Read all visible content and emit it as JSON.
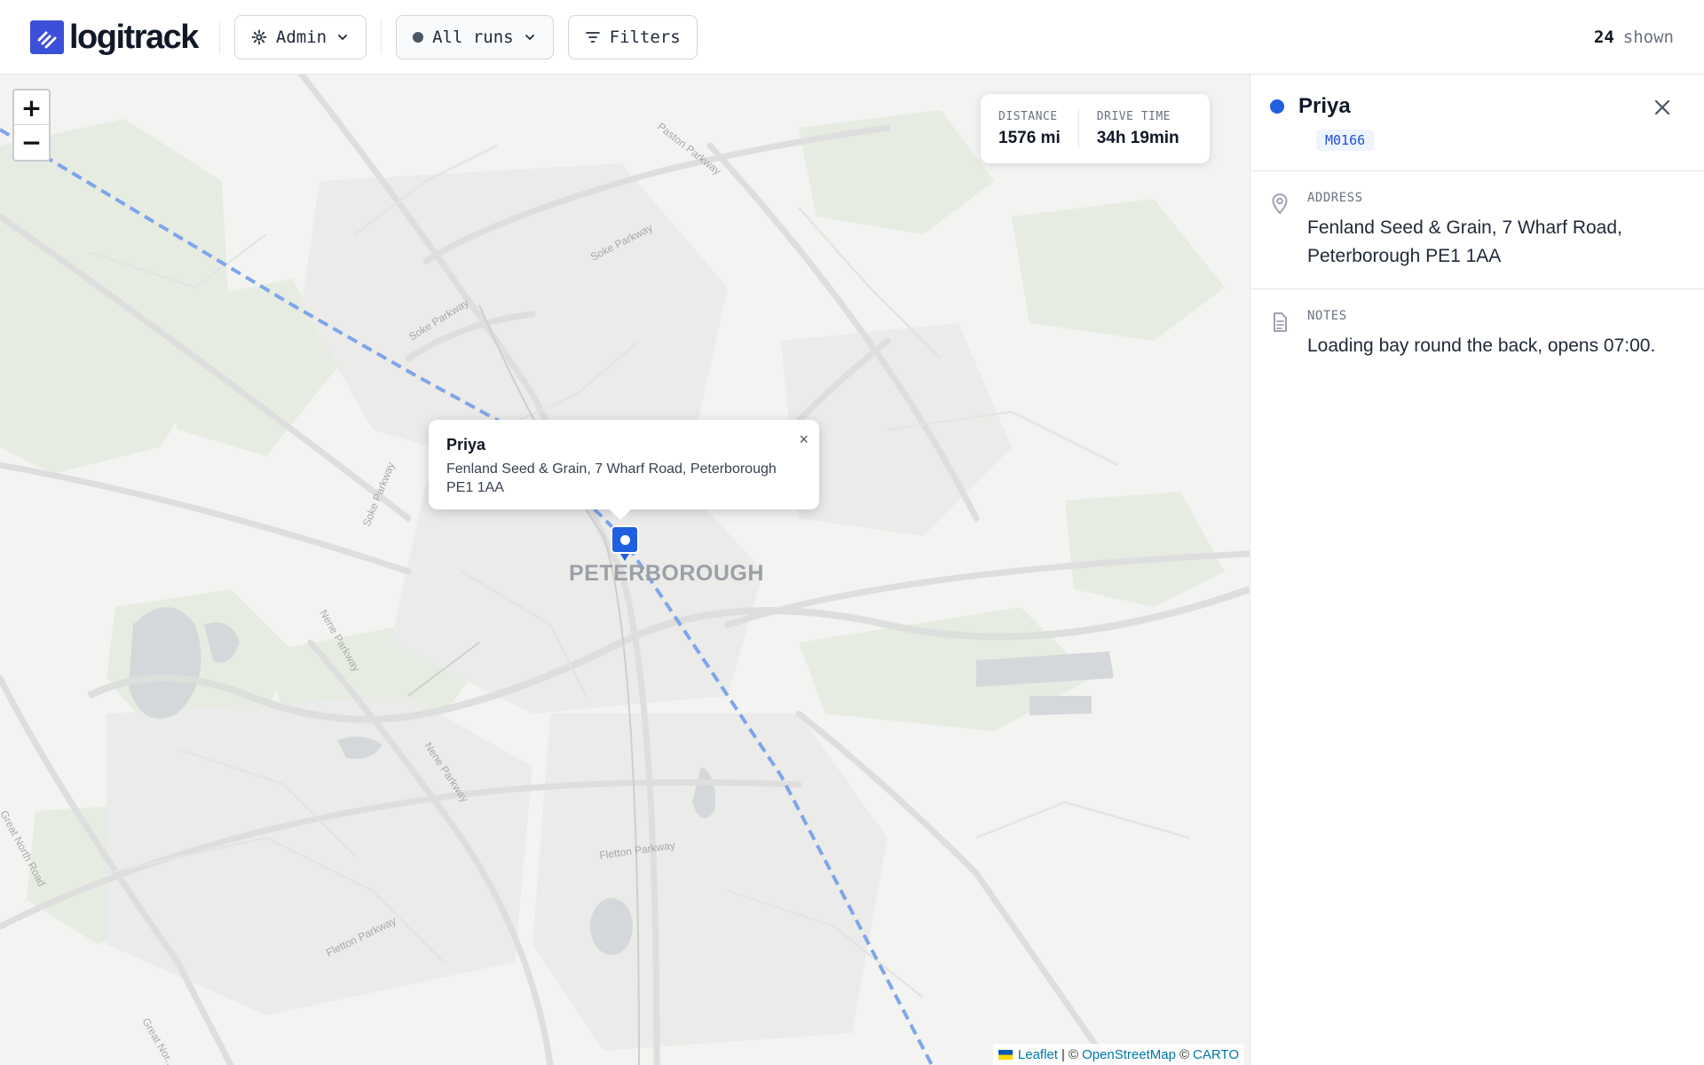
{
  "header": {
    "logo": "logitrack",
    "role_label": "Admin",
    "runs_label": "All runs",
    "filters_label": "Filters",
    "shown_count": "24",
    "shown_label": "shown"
  },
  "map": {
    "zoom_in": "+",
    "zoom_out": "−",
    "city_label": "PETERBOROUGH",
    "road_labels": [
      "Paston Parkway",
      "Soke Parkway",
      "Soke Parkway",
      "Soke Parkway",
      "Nene Parkway",
      "Nene Parkway",
      "Fletton Parkway",
      "Fletton Parkway",
      "Great North Road",
      "Great Nor..."
    ],
    "stats": {
      "distance_label": "DISTANCE",
      "distance_value": "1576 mi",
      "drive_time_label": "DRIVE TIME",
      "drive_time_value": "34h 19min"
    },
    "popup": {
      "title": "Priya",
      "address": "Fenland Seed & Grain, 7 Wharf Road, Peterborough PE1 1AA",
      "close": "×"
    },
    "attribution": {
      "leaflet": "Leaflet",
      "sep1": "| ©",
      "osm": "OpenStreetMap",
      "sep2": "©",
      "carto": "CARTO"
    },
    "route_color": "#7fa5ea",
    "marker_color": "#1f5fe0"
  },
  "panel": {
    "name": "Priya",
    "code": "M0166",
    "address_label": "ADDRESS",
    "address": "Fenland Seed & Grain, 7 Wharf Road, Peterborough PE1 1AA",
    "notes_label": "NOTES",
    "notes": "Loading bay round the back, opens 07:00.",
    "accent_color": "#1f5fe0"
  }
}
